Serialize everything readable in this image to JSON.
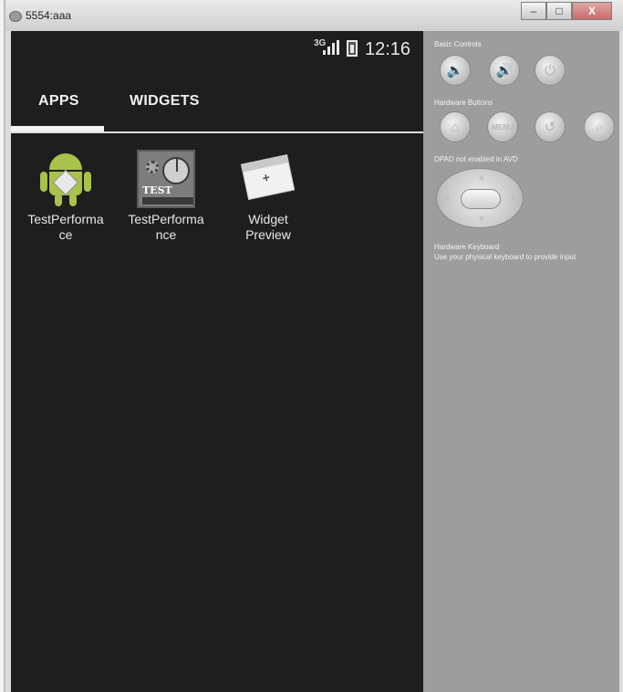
{
  "window": {
    "title": "5554:aaa"
  },
  "window_controls": {
    "minimize": "–",
    "maximize": "□",
    "close": "X"
  },
  "status_bar": {
    "network": "3G",
    "time": "12:16"
  },
  "tabs": [
    {
      "label": "APPS",
      "selected": true
    },
    {
      "label": "WIDGETS",
      "selected": false
    }
  ],
  "apps": [
    {
      "label": "TestPerforma\nce",
      "icon": "android-robot-icon"
    },
    {
      "label": "TestPerforma\nnce",
      "icon": "test-performance-icon",
      "icon_text": "TEST"
    },
    {
      "label": "Widget\nPreview",
      "icon": "widget-preview-icon"
    }
  ],
  "controls": {
    "basic_controls_label": "Basic Controls",
    "hardware_buttons_label": "Hardware Buttons",
    "dpad_label": "DPAD not enabled in AVD",
    "keyboard_label": "Hardware Keyboard",
    "keyboard_hint": "Use your physical keyboard to provide input",
    "menu_label": "MENU"
  },
  "colors": {
    "screen_bg": "#1e1e1e",
    "panel_bg": "#9d9d9d",
    "android_green": "#a9c24b"
  }
}
